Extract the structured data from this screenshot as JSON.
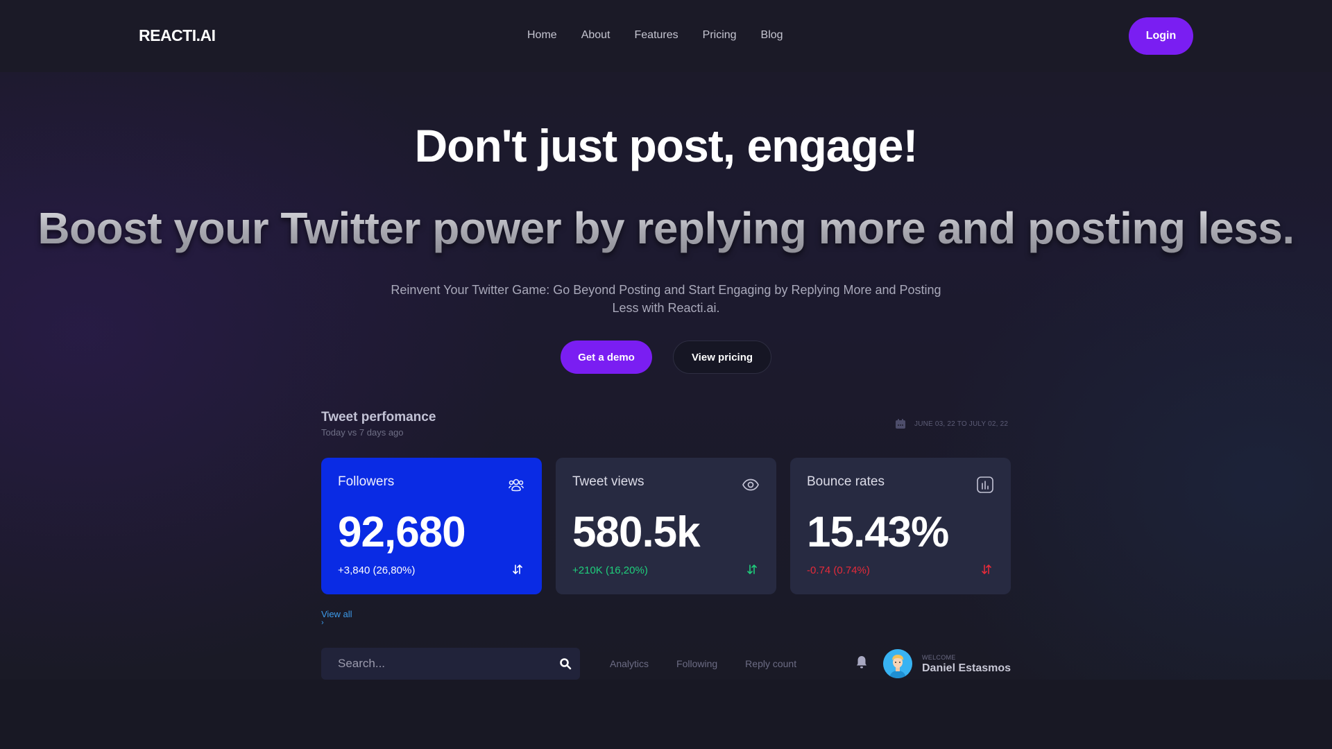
{
  "header": {
    "logo": "REACTI.AI",
    "nav": [
      "Home",
      "About",
      "Features",
      "Pricing",
      "Blog"
    ],
    "login_label": "Login"
  },
  "hero": {
    "title": "Don't just post, engage!",
    "subtitle": "Boost your Twitter power by replying more and posting less.",
    "lead": "Reinvent Your Twitter Game: Go Beyond Posting and Start Engaging by Replying More and Posting Less with Reacti.ai.",
    "primary_cta": "Get a demo",
    "secondary_cta": "View pricing"
  },
  "performance": {
    "title": "Tweet perfomance",
    "subtitle": "Today vs 7 days ago",
    "date_range": "JUNE 03, 22 TO JULY 02, 22",
    "cards": [
      {
        "label": "Followers",
        "icon": "users-icon",
        "value": "92,680",
        "delta": "+3,840 (26,80%)",
        "delta_color": "#ffffff"
      },
      {
        "label": "Tweet views",
        "icon": "eye-icon",
        "value": "580.5k",
        "delta": "+210K (16,20%)",
        "delta_color": "#1fcf7c"
      },
      {
        "label": "Bounce rates",
        "icon": "bar-chart-icon",
        "value": "15.43%",
        "delta": "-0.74 (0.74%)",
        "delta_color": "#e52b3a"
      }
    ],
    "view_all": "View all",
    "view_all_chevron": "›"
  },
  "toolbar": {
    "search_placeholder": "Search...",
    "tabs": [
      "Analytics",
      "Following",
      "Reply count"
    ],
    "welcome_label": "WELCOME",
    "user_name": "Daniel Estasmos"
  },
  "colors": {
    "accent": "#7a1ef2",
    "card_blue": "#0a2be4",
    "card_dark": "#272a41",
    "link": "#3d9bea"
  }
}
